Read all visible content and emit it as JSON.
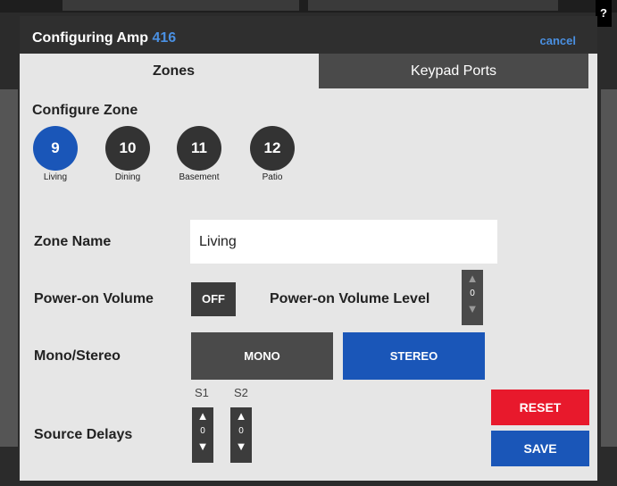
{
  "help": {
    "label": "?"
  },
  "dialog": {
    "title_prefix": "Configuring Amp",
    "amp_number": "416",
    "cancel_label": "cancel"
  },
  "tabs": [
    {
      "label": "Zones",
      "active": true
    },
    {
      "label": "Keypad Ports",
      "active": false
    }
  ],
  "configure_zone": {
    "title": "Configure Zone",
    "zones": [
      {
        "number": "9",
        "name": "Living",
        "selected": true
      },
      {
        "number": "10",
        "name": "Dining",
        "selected": false
      },
      {
        "number": "11",
        "name": "Basement",
        "selected": false
      },
      {
        "number": "12",
        "name": "Patio",
        "selected": false
      }
    ]
  },
  "zone_name": {
    "label": "Zone Name",
    "value": "Living"
  },
  "power_on_volume": {
    "label": "Power-on Volume",
    "toggle_value": "OFF"
  },
  "power_on_volume_level": {
    "label": "Power-on Volume Level",
    "value": "0"
  },
  "mono_stereo": {
    "label": "Mono/Stereo",
    "mono_label": "MONO",
    "stereo_label": "STEREO",
    "selected": "STEREO"
  },
  "source_delays": {
    "label": "Source Delays",
    "sources": [
      {
        "name": "S1",
        "value": "0"
      },
      {
        "name": "S2",
        "value": "0"
      }
    ]
  },
  "actions": {
    "reset_label": "RESET",
    "save_label": "SAVE"
  },
  "colors": {
    "accent_blue": "#1a56b8",
    "reset_red": "#e8192c",
    "link_blue": "#4a90e2"
  }
}
